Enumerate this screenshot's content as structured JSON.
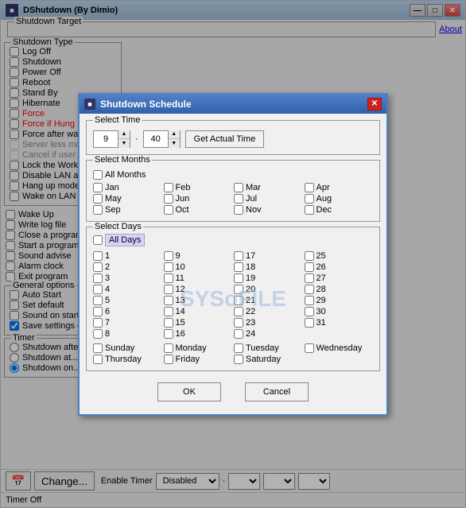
{
  "mainWindow": {
    "title": "DShutdown (By Dimio)",
    "icon": "⬛"
  },
  "titleBar": {
    "minimize": "—",
    "restore": "□",
    "close": "✕"
  },
  "shutdownType": {
    "label": "Shutdown Type",
    "items": [
      {
        "label": "Log Off",
        "checked": false,
        "color": "normal"
      },
      {
        "label": "Shutdown",
        "checked": false,
        "color": "normal"
      },
      {
        "label": "Power Off",
        "checked": false,
        "color": "normal"
      },
      {
        "label": "Reboot",
        "checked": false,
        "color": "normal"
      },
      {
        "label": "Stand By",
        "checked": false,
        "color": "normal"
      },
      {
        "label": "Hibernate",
        "checked": false,
        "color": "normal"
      },
      {
        "label": "Force",
        "checked": false,
        "color": "red"
      },
      {
        "label": "Force if Hung",
        "checked": false,
        "color": "red"
      },
      {
        "label": "Force after wait",
        "checked": false,
        "color": "normal"
      },
      {
        "label": "Server less mode",
        "checked": false,
        "color": "gray"
      },
      {
        "label": "Cancel if user is logg...",
        "checked": false,
        "color": "gray"
      },
      {
        "label": "Lock the Workstatio...",
        "checked": false,
        "color": "normal"
      },
      {
        "label": "Disable LAN adapte...",
        "checked": false,
        "color": "normal"
      },
      {
        "label": "Hang up modem",
        "checked": false,
        "color": "normal"
      },
      {
        "label": "Wake on LAN",
        "checked": false,
        "color": "normal"
      }
    ]
  },
  "generalOptions": {
    "label": "General options",
    "items": [
      {
        "label": "Auto Start",
        "checked": false
      },
      {
        "label": "Set default",
        "checked": false
      },
      {
        "label": "Sound on start",
        "checked": false
      },
      {
        "label": "Save settings on exi...",
        "checked": true
      }
    ]
  },
  "timer": {
    "label": "Timer",
    "items": [
      {
        "label": "Shutdown after...",
        "checked": false
      },
      {
        "label": "Shutdown at...",
        "checked": false
      },
      {
        "label": "Shutdown on...",
        "checked": true
      }
    ]
  },
  "shutdownTarget": {
    "label": "Shutdown Target",
    "about": "About"
  },
  "bottomBar": {
    "calendarIcon": "📅",
    "changeLabel": "Change...",
    "enableTimer": "Enable Timer",
    "dropdowns": [
      "Disabled",
      "",
      "",
      ""
    ],
    "statusBar": "Timer Off"
  },
  "modal": {
    "title": "Shutdown Schedule",
    "icon": "⬛",
    "close": "✕",
    "selectTime": {
      "label": "Select Time",
      "hour": "9",
      "minute": "40",
      "getActualTime": "Get Actual Time"
    },
    "selectMonths": {
      "label": "Select Months",
      "allMonths": "All Months",
      "months": [
        "Jan",
        "Feb",
        "Mar",
        "Apr",
        "May",
        "Jun",
        "Jul",
        "Aug",
        "Sep",
        "Oct",
        "Nov",
        "Dec"
      ],
      "checked": [
        false,
        false,
        false,
        false,
        false,
        false,
        false,
        false,
        false,
        false,
        false,
        false
      ]
    },
    "selectDays": {
      "label": "Select Days",
      "allDays": "All Days",
      "days": [
        "1",
        "2",
        "3",
        "4",
        "5",
        "6",
        "7",
        "8",
        "9",
        "10",
        "11",
        "12",
        "13",
        "14",
        "15",
        "16",
        "17",
        "18",
        "19",
        "20",
        "21",
        "22",
        "23",
        "24",
        "25",
        "26",
        "27",
        "28",
        "29",
        "30",
        "31"
      ],
      "weekdays": [
        "Sunday",
        "Monday",
        "Tuesday",
        "Wednesday",
        "Thursday",
        "Friday",
        "Saturday"
      ],
      "weekdayChecked": [
        false,
        false,
        false,
        false,
        false,
        false,
        false
      ]
    },
    "ok": "OK",
    "cancel": "Cancel",
    "watermark": "SYSoFILE"
  }
}
